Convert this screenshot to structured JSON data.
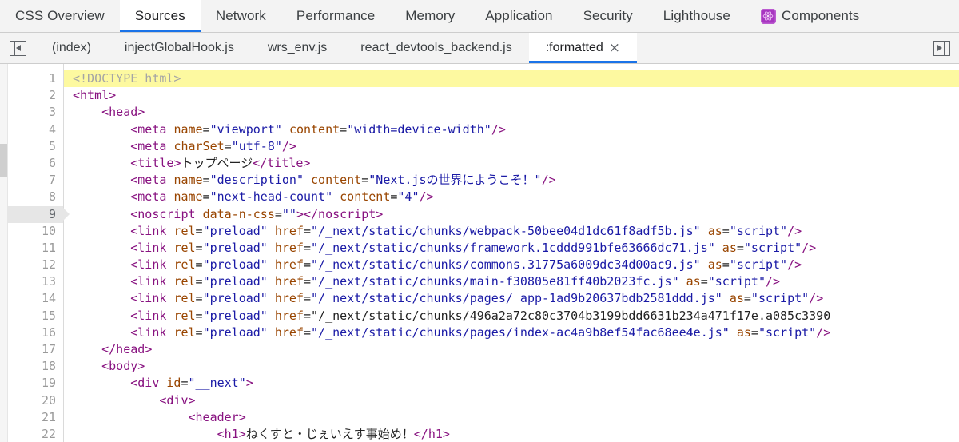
{
  "panel_tabs": [
    {
      "label": "CSS Overview",
      "active": false,
      "icon": null
    },
    {
      "label": "Sources",
      "active": true,
      "icon": null
    },
    {
      "label": "Network",
      "active": false,
      "icon": null
    },
    {
      "label": "Performance",
      "active": false,
      "icon": null
    },
    {
      "label": "Memory",
      "active": false,
      "icon": null
    },
    {
      "label": "Application",
      "active": false,
      "icon": null
    },
    {
      "label": "Security",
      "active": false,
      "icon": null
    },
    {
      "label": "Lighthouse",
      "active": false,
      "icon": null
    },
    {
      "label": "Components",
      "active": false,
      "icon": "react-components-icon"
    }
  ],
  "file_tabbar": {
    "left_toggle_icon": "collapse-left-panel-icon",
    "right_toggle_icon": "expand-right-panel-icon",
    "tabs": [
      {
        "label": "(index)",
        "active": false,
        "closable": false
      },
      {
        "label": "injectGlobalHook.js",
        "active": false,
        "closable": false
      },
      {
        "label": "wrs_env.js",
        "active": false,
        "closable": false
      },
      {
        "label": "react_devtools_backend.js",
        "active": false,
        "closable": false
      },
      {
        "label": ":formatted",
        "active": true,
        "closable": true
      }
    ],
    "close_glyph": "×"
  },
  "editor": {
    "highlighted_line": 1,
    "execution_line": 9,
    "line_numbers": [
      1,
      2,
      3,
      4,
      5,
      6,
      7,
      8,
      9,
      10,
      11,
      12,
      13,
      14,
      15,
      16,
      17,
      18,
      19,
      20,
      21,
      22
    ],
    "lines": [
      {
        "n": 1,
        "text": "<!DOCTYPE html>"
      },
      {
        "n": 2,
        "text": "<html>"
      },
      {
        "n": 3,
        "text": "    <head>"
      },
      {
        "n": 4,
        "text": "        <meta name=\"viewport\" content=\"width=device-width\"/>"
      },
      {
        "n": 5,
        "text": "        <meta charSet=\"utf-8\"/>"
      },
      {
        "n": 6,
        "text": "        <title>トップページ</title>"
      },
      {
        "n": 7,
        "text": "        <meta name=\"description\" content=\"Next.jsの世界にようこそ！\"/>"
      },
      {
        "n": 8,
        "text": "        <meta name=\"next-head-count\" content=\"4\"/>"
      },
      {
        "n": 9,
        "text": "        <noscript data-n-css=\"\"></noscript>"
      },
      {
        "n": 10,
        "text": "        <link rel=\"preload\" href=\"/_next/static/chunks/webpack-50bee04d1dc61f8adf5b.js\" as=\"script\"/>"
      },
      {
        "n": 11,
        "text": "        <link rel=\"preload\" href=\"/_next/static/chunks/framework.1cddd991bfe63666dc71.js\" as=\"script\"/>"
      },
      {
        "n": 12,
        "text": "        <link rel=\"preload\" href=\"/_next/static/chunks/commons.31775a6009dc34d00ac9.js\" as=\"script\"/>"
      },
      {
        "n": 13,
        "text": "        <link rel=\"preload\" href=\"/_next/static/chunks/main-f30805e81ff40b2023fc.js\" as=\"script\"/>"
      },
      {
        "n": 14,
        "text": "        <link rel=\"preload\" href=\"/_next/static/chunks/pages/_app-1ad9b20637bdb2581ddd.js\" as=\"script\"/>"
      },
      {
        "n": 15,
        "text": "        <link rel=\"preload\" href=\"/_next/static/chunks/496a2a72c80c3704b3199bdd6631b234a471f17e.a085c3390"
      },
      {
        "n": 16,
        "text": "        <link rel=\"preload\" href=\"/_next/static/chunks/pages/index-ac4a9b8ef54fac68ee4e.js\" as=\"script\"/>"
      },
      {
        "n": 17,
        "text": "    </head>"
      },
      {
        "n": 18,
        "text": "    <body>"
      },
      {
        "n": 19,
        "text": "        <div id=\"__next\">"
      },
      {
        "n": 20,
        "text": "            <div>"
      },
      {
        "n": 21,
        "text": "                <header>"
      },
      {
        "n": 22,
        "text": "                    <h1>ねくすと・じぇいえす事始め！</h1>"
      }
    ]
  },
  "colors": {
    "accent_blue": "#1a73e8",
    "tag": "#881280",
    "attr_name": "#994500",
    "attr_value": "#1a1aa6",
    "doctype": "#a5a5a5",
    "highlight_row": "#fdf9a0",
    "exec_row_gutter": "#e6e6e6",
    "react_icon": "#a736c0",
    "toolbar_bg": "#f3f3f3"
  }
}
